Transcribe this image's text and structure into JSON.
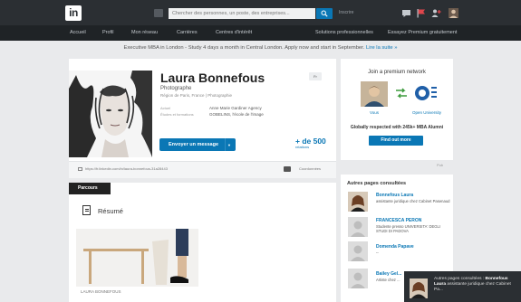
{
  "header": {
    "logo": "in",
    "search_placeholder": "Chercher des personnes, un poste, des entreprises...",
    "search_scope": "Inscrire"
  },
  "nav": [
    "Accueil",
    "Profil",
    "Mon réseau",
    "Carrières",
    "Centres d'intérêt",
    "Solutions professionnelles",
    "Essayez Premium gratuitement"
  ],
  "banner": {
    "text": "Executive MBA in London - Study 4 days a month in Central London. Apply now and start in September.",
    "link": "Lire la suite »"
  },
  "profile": {
    "name": "Laura Bonnefous",
    "headline": "Photographe",
    "location": "Région de Paris, France | Photographie",
    "previous_label": "Actuel",
    "previous_value": "Anne Marie Gardiner Agency",
    "education_label": "Études et formations",
    "education_value": "GOBELINS, l'école de l'image",
    "lang": "Fr",
    "message_button": "Envoyer un message",
    "connections_count": "+ de 500",
    "connections_label": "relations",
    "url": "https://fr.linkedin.com/in/laura-bonnefous-31a28443",
    "contact_label": "Coordonnées"
  },
  "section": {
    "tab": "Parcours",
    "resume_title": "Résumé",
    "media_caption": "LAURA BONNEFOUS"
  },
  "premium": {
    "title": "Join a premium network",
    "you": "Vous",
    "university": "Open University",
    "text": "Globally respected with 245k+ MBA Alumni",
    "button": "Find out more",
    "pub": "Pub"
  },
  "also_viewed": {
    "title": "Autres pages consultées",
    "people": [
      {
        "name": "Bonnefous Laura",
        "desc": "assistante juridique chez Cabinet Pasenaud"
      },
      {
        "name": "FRANCESCA PERON",
        "desc": "Studente presso UNIVERSITA' DEGLI STUDI DI PADOVA"
      },
      {
        "name": "Domenda Papave",
        "desc": "--"
      },
      {
        "name": "Bailey Gel...",
        "desc": "Artiste chez ..."
      }
    ]
  },
  "toast": {
    "title": "Autres pages consultées :",
    "name": "Bonnefous Laura",
    "desc": "assistante juridique chez Cabinet Pa..."
  },
  "colors": {
    "brand": "#0a77b5",
    "topbar": "#2b2f33"
  }
}
